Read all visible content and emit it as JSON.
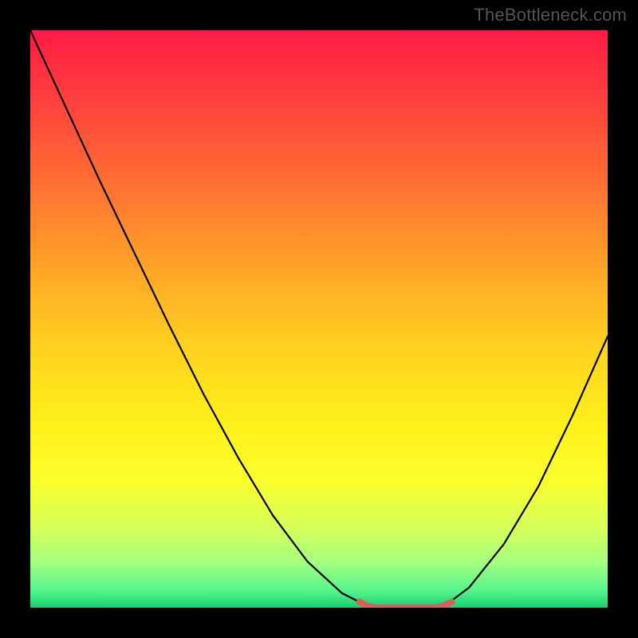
{
  "watermark": "TheBottleneck.com",
  "chart_data": {
    "type": "line",
    "title": "",
    "xlabel": "",
    "ylabel": "",
    "xlim": [
      0,
      1
    ],
    "ylim": [
      0,
      1
    ],
    "background_gradient": {
      "stops": [
        {
          "offset": 0.0,
          "color": "#ff1b45"
        },
        {
          "offset": 0.1,
          "color": "#ff3a3e"
        },
        {
          "offset": 0.25,
          "color": "#ff6a33"
        },
        {
          "offset": 0.4,
          "color": "#ffa029"
        },
        {
          "offset": 0.55,
          "color": "#ffd21f"
        },
        {
          "offset": 0.68,
          "color": "#fff01a"
        },
        {
          "offset": 0.78,
          "color": "#faff2d"
        },
        {
          "offset": 0.86,
          "color": "#d7ff5a"
        },
        {
          "offset": 0.92,
          "color": "#a6ff7e"
        },
        {
          "offset": 0.97,
          "color": "#57f58e"
        },
        {
          "offset": 1.0,
          "color": "#18cf6d"
        }
      ]
    },
    "series": [
      {
        "name": "curve",
        "color": "#000000",
        "x": [
          0.0,
          0.06,
          0.12,
          0.18,
          0.24,
          0.3,
          0.36,
          0.42,
          0.48,
          0.54,
          0.58,
          0.61,
          0.64,
          0.7,
          0.72,
          0.76,
          0.82,
          0.88,
          0.94,
          1.0
        ],
        "y": [
          1.0,
          0.87,
          0.74,
          0.615,
          0.49,
          0.37,
          0.26,
          0.16,
          0.08,
          0.025,
          0.005,
          0.0,
          0.0,
          0.0,
          0.005,
          0.035,
          0.11,
          0.21,
          0.335,
          0.47
        ]
      },
      {
        "name": "flat-region",
        "color": "#d9605a",
        "x": [
          0.57,
          0.585,
          0.6,
          0.62,
          0.64,
          0.66,
          0.68,
          0.7,
          0.715,
          0.73
        ],
        "y": [
          0.01,
          0.003,
          0.0,
          0.0,
          0.0,
          0.0,
          0.0,
          0.0,
          0.003,
          0.01
        ]
      }
    ]
  }
}
